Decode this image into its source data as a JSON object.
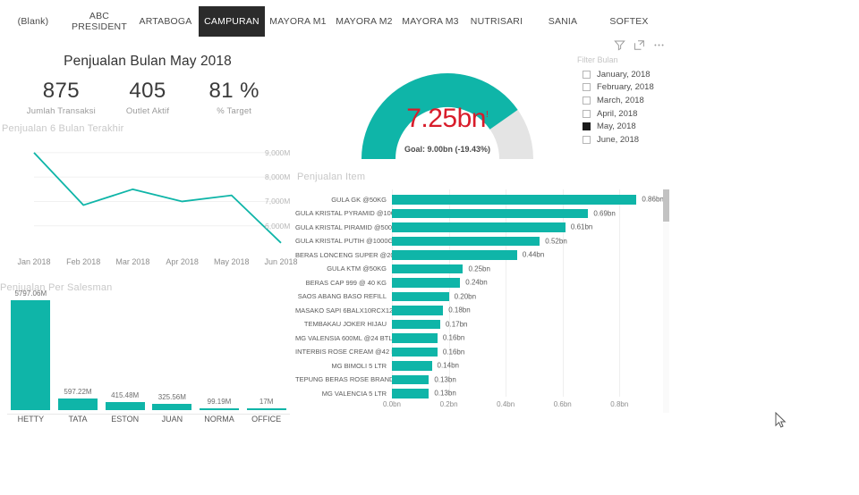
{
  "tabs": [
    {
      "label": "(Blank)",
      "selected": false
    },
    {
      "label": "ABC\nPRESIDENT",
      "selected": false
    },
    {
      "label": "ARTABOGA",
      "selected": false
    },
    {
      "label": "CAMPURAN",
      "selected": true
    },
    {
      "label": "MAYORA M1",
      "selected": false
    },
    {
      "label": "MAYORA M2",
      "selected": false
    },
    {
      "label": "MAYORA M3",
      "selected": false
    },
    {
      "label": "NUTRISARI",
      "selected": false
    },
    {
      "label": "SANIA",
      "selected": false
    },
    {
      "label": "SOFTEX",
      "selected": false
    }
  ],
  "kpi": {
    "title": "Penjualan Bulan May 2018",
    "metrics": [
      {
        "value": "875",
        "label": "Jumlah Transaksi"
      },
      {
        "value": "405",
        "label": "Outlet Aktif"
      },
      {
        "value": "81 %",
        "label": "% Target"
      }
    ]
  },
  "gauge": {
    "value_label": "7.25bn",
    "superscript": "!",
    "goal_label": "Goal: 9.00bn (-19.43%)",
    "value": 7.25,
    "goal": 9.0,
    "max": 9.0,
    "fill_color": "#0fb5a8",
    "track_color": "#e4e4e4",
    "value_color": "#d81c2a"
  },
  "filter": {
    "title": "Filter Bulan",
    "icons": [
      "filter-icon",
      "focus-mode-icon",
      "more-options-icon"
    ],
    "options": [
      {
        "label": "January, 2018",
        "checked": false
      },
      {
        "label": "February, 2018",
        "checked": false
      },
      {
        "label": "March, 2018",
        "checked": false
      },
      {
        "label": "April, 2018",
        "checked": false
      },
      {
        "label": "May, 2018",
        "checked": true
      },
      {
        "label": "June, 2018",
        "checked": false
      }
    ]
  },
  "chart_data": [
    {
      "type": "line",
      "title": "Penjualan 6 Bulan Terakhir",
      "xlabel": "",
      "ylabel": "",
      "categories": [
        "Jan 2018",
        "Feb 2018",
        "Mar 2018",
        "Apr 2018",
        "May 2018",
        "Jun 2018"
      ],
      "values": [
        9000,
        6850,
        7500,
        7000,
        7250,
        5300
      ],
      "tick_labels": [
        "9,000M",
        "8,000M",
        "7,000M",
        "6,000M"
      ],
      "ticks": [
        9000,
        8000,
        7000,
        6000
      ],
      "ylim": [
        5000,
        9400
      ],
      "grid": true,
      "line_color": "#0fb5a8"
    },
    {
      "type": "bar",
      "title": "Penjualan Per Salesman",
      "orientation": "vertical",
      "xlabel": "",
      "ylabel": "",
      "categories": [
        "HETTY",
        "TATA",
        "ESTON",
        "JUAN",
        "NORMA",
        "OFFICE"
      ],
      "values": [
        5797.06,
        597.22,
        415.48,
        325.56,
        99.19,
        17
      ],
      "data_labels": [
        "5797.06M",
        "597.22M",
        "415.48M",
        "325.56M",
        "99.19M",
        "17M"
      ],
      "ylim": [
        0,
        5797.06
      ],
      "grid": false,
      "bar_color": "#0fb5a8"
    },
    {
      "type": "bar",
      "title": "Penjualan Item",
      "orientation": "horizontal",
      "xlabel": "",
      "ylabel": "",
      "categories": [
        "GULA GK @50KG",
        "GULA KRISTAL PYRAMID @100...",
        "GULA KRISTAL PIRAMID @500GR",
        "GULA KRISTAL PUTIH @1000GR",
        "BERAS LONCENG SUPER @20...",
        "GULA KTM @50KG",
        "BERAS CAP 999 @ 40 KG",
        "SAOS ABANG BASO REFILL",
        "MASAKO SAPI 6BALX10RCX12...",
        "TEMBAKAU JOKER HIJAU",
        "MG VALENSIA 600ML @24 BTL",
        "INTERBIS ROSE CREAM @42 P...",
        "MG BIMOLI 5 LTR",
        "TEPUNG BERAS ROSE BRAND",
        "MG VALENCIA 5 LTR"
      ],
      "values": [
        0.86,
        0.69,
        0.61,
        0.52,
        0.44,
        0.25,
        0.24,
        0.2,
        0.18,
        0.17,
        0.16,
        0.16,
        0.14,
        0.13,
        0.13
      ],
      "data_labels": [
        "0.86bn",
        "0.69bn",
        "0.61bn",
        "0.52bn",
        "0.44bn",
        "0.25bn",
        "0.24bn",
        "0.20bn",
        "0.18bn",
        "0.17bn",
        "0.16bn",
        "0.16bn",
        "0.14bn",
        "0.13bn",
        "0.13bn"
      ],
      "tick_labels": [
        "0.0bn",
        "0.2bn",
        "0.4bn",
        "0.6bn",
        "0.8bn"
      ],
      "ticks": [
        0.0,
        0.2,
        0.4,
        0.6,
        0.8
      ],
      "xlim": [
        0,
        0.95
      ],
      "grid": true,
      "bar_color": "#0fb5a8"
    }
  ]
}
